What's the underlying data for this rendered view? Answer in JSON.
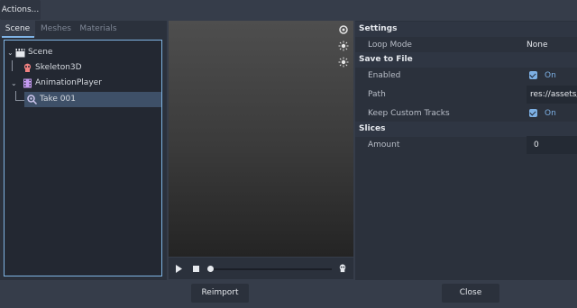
{
  "toolbar": {
    "actions_label": "Actions..."
  },
  "left_tabs": [
    "Scene",
    "Meshes",
    "Materials"
  ],
  "tree": {
    "items": [
      {
        "label": "Scene",
        "icon": "clapperboard-icon"
      },
      {
        "label": "Skeleton3D",
        "icon": "skeleton-icon"
      },
      {
        "label": "AnimationPlayer",
        "icon": "animation-player-icon"
      },
      {
        "label": "Take 001",
        "icon": "animation-icon"
      }
    ]
  },
  "settings": {
    "header": "Settings",
    "loop_mode_label": "Loop Mode",
    "loop_mode_value": "None"
  },
  "save_to_file": {
    "header": "Save to File",
    "enabled_label": "Enabled",
    "enabled_value": "On",
    "path_label": "Path",
    "path_value": "res://assets/p",
    "keep_label": "Keep Custom Tracks",
    "keep_value": "On"
  },
  "slices": {
    "header": "Slices",
    "amount_label": "Amount",
    "amount_value": "0"
  },
  "buttons": {
    "reimport": "Reimport",
    "close": "Close"
  },
  "colors": {
    "accent": "#7db0e4",
    "selection": "#3e5068",
    "panel": "#2b313c"
  }
}
